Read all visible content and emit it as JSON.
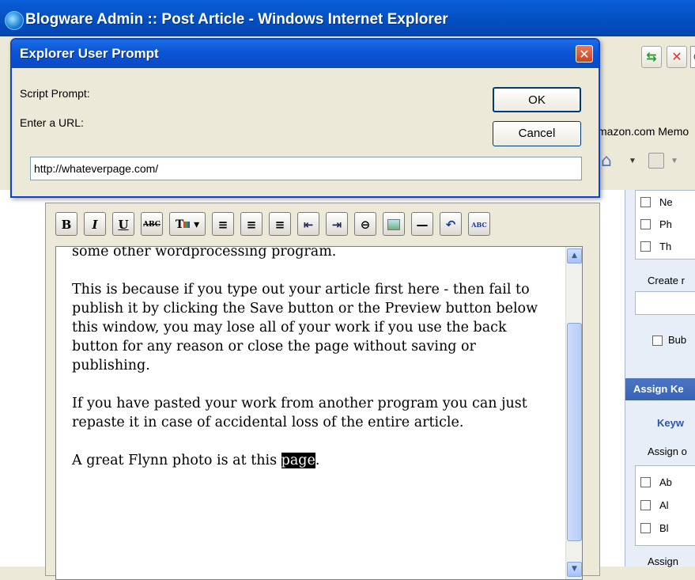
{
  "window": {
    "title": "Blogware Admin :: Post Article - Windows Internet Explorer",
    "address_partial": "Go"
  },
  "favorites_bar": {
    "partial_text": "mazon.com Memo"
  },
  "dialog": {
    "title": "Explorer User Prompt",
    "label_script": "Script Prompt:",
    "label_prompt": "Enter a URL:",
    "ok_label": "OK",
    "cancel_label": "Cancel",
    "url_value": "http://whateverpage.com/",
    "close_glyph": "✕"
  },
  "editor": {
    "toolbar": {
      "bold": "B",
      "italic": "I",
      "underline": "U",
      "strike": "ABC",
      "align_left": "≡",
      "align_center": "≡",
      "align_right": "≡",
      "outdent": "⇤",
      "indent": "⇥",
      "link": "⊖",
      "hr": "—",
      "undo": "↶",
      "spell": "ABC"
    },
    "paragraphs": {
      "p0": "some other wordprocessing program.",
      "p1": "This is because if you type out your article first here - then fail to publish it by clicking the Save button or the Preview button below this window, you may lose all of your work if you use the back button for any reason or close the page without saving or publishing.",
      "p2": "If you have pasted your work from another program you can just repaste it in case of accidental loss of the entire article.",
      "p3_prefix": "A great Flynn photo is at this ",
      "p3_selected": "page",
      "p3_suffix": "."
    }
  },
  "right_panel": {
    "items_top": [
      "Ne",
      "Ph",
      "Th"
    ],
    "create_label": "Create r",
    "bub_label": "Bub",
    "assign_header": "Assign Ke",
    "keyw_label": "Keyw",
    "assign_o": "Assign o",
    "items_bottom": [
      "Ab",
      "Al",
      "Bl"
    ],
    "assign_bottom": "Assign"
  },
  "colors": {
    "titlebar": "#0553c7",
    "dialog_border": "#0b44c7",
    "selection": "#000000"
  }
}
